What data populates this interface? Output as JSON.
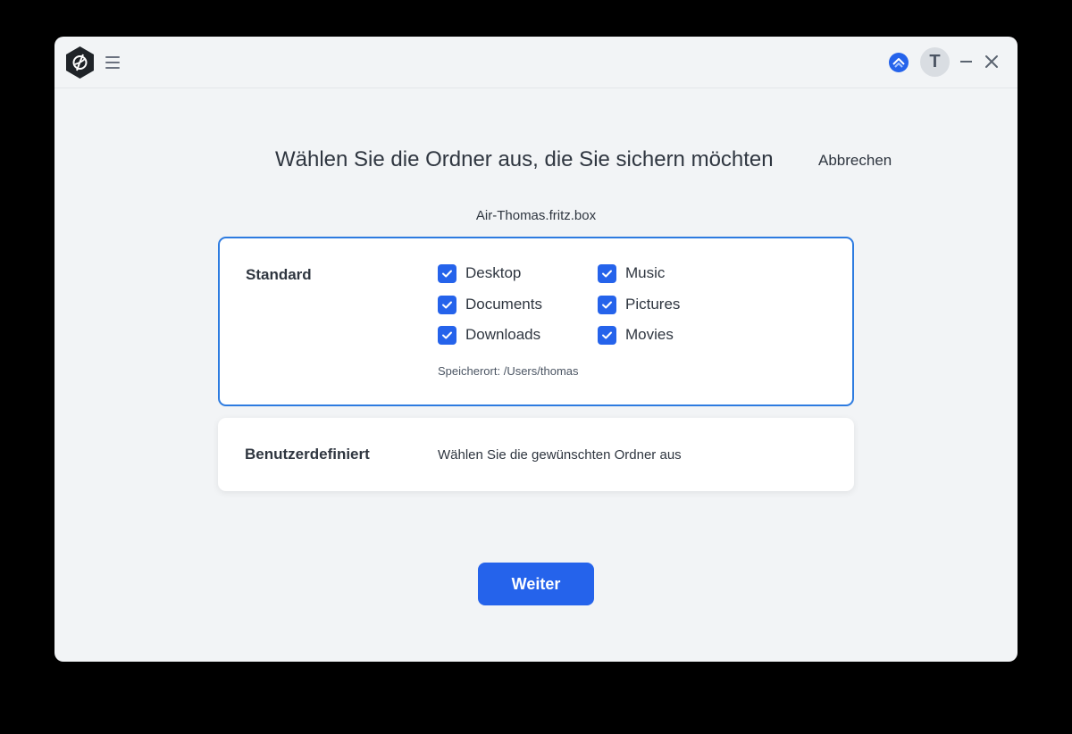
{
  "titlebar": {
    "avatar_initial": "T"
  },
  "main": {
    "title": "Wählen Sie die Ordner aus, die Sie sichern möchten",
    "cancel_label": "Abbrechen",
    "host": "Air-Thomas.fritz.box"
  },
  "standard": {
    "label": "Standard",
    "folders": [
      {
        "label": "Desktop",
        "checked": true
      },
      {
        "label": "Documents",
        "checked": true
      },
      {
        "label": "Downloads",
        "checked": true
      },
      {
        "label": "Music",
        "checked": true
      },
      {
        "label": "Pictures",
        "checked": true
      },
      {
        "label": "Movies",
        "checked": true
      }
    ],
    "location": "Speicherort: /Users/thomas"
  },
  "custom": {
    "label": "Benutzerdefiniert",
    "description": "Wählen Sie die gewünschten Ordner aus"
  },
  "footer": {
    "next_label": "Weiter"
  },
  "colors": {
    "accent": "#2563eb",
    "background": "#f2f4f6"
  }
}
